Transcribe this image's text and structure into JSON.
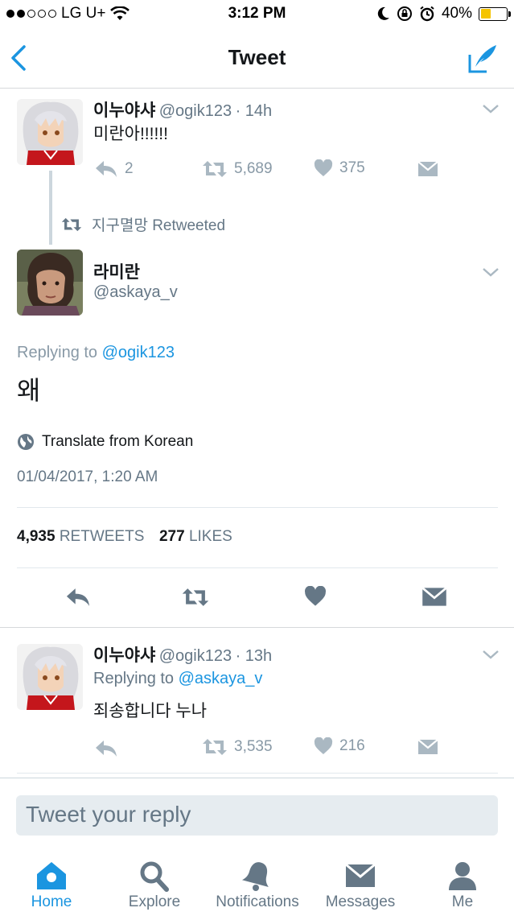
{
  "status_bar": {
    "carrier": "LG U+",
    "time": "3:12 PM",
    "battery": "40%",
    "battery_level": 0.4
  },
  "navbar": {
    "title": "Tweet"
  },
  "parent_tweet": {
    "name": "이누야샤",
    "handle": "@ogik123",
    "time": "· 14h",
    "text": "미란아!!!!!!",
    "replies": "2",
    "retweets": "5,689",
    "likes": "375"
  },
  "retweet_context": {
    "label": "지구멸망 Retweeted"
  },
  "main_tweet": {
    "name": "라미란",
    "handle": "@askaya_v",
    "replying_prefix": "Replying to",
    "replying_to": "@ogik123",
    "text": "왜",
    "translate": "Translate from Korean",
    "timestamp": "01/04/2017, 1:20 AM",
    "retweet_count": "4,935",
    "retweet_label": "RETWEETS",
    "like_count": "277",
    "like_label": "LIKES"
  },
  "reply_tweet": {
    "name": "이누야샤",
    "handle": "@ogik123",
    "time": "· 13h",
    "replying_prefix": "Replying to",
    "replying_to": "@askaya_v",
    "text": "죄송합니다 누나",
    "retweets": "3,535",
    "likes": "216"
  },
  "reply_box": {
    "placeholder": "Tweet your reply"
  },
  "tabs": [
    {
      "label": "Home",
      "icon": "home-icon",
      "active": true
    },
    {
      "label": "Explore",
      "icon": "search-icon",
      "active": false
    },
    {
      "label": "Notifications",
      "icon": "bell-icon",
      "active": false
    },
    {
      "label": "Messages",
      "icon": "envelope-icon",
      "active": false
    },
    {
      "label": "Me",
      "icon": "person-icon",
      "active": false
    }
  ],
  "colors": {
    "accent": "#1b95e0",
    "gray": "#8899a6",
    "text": "#14171a"
  }
}
